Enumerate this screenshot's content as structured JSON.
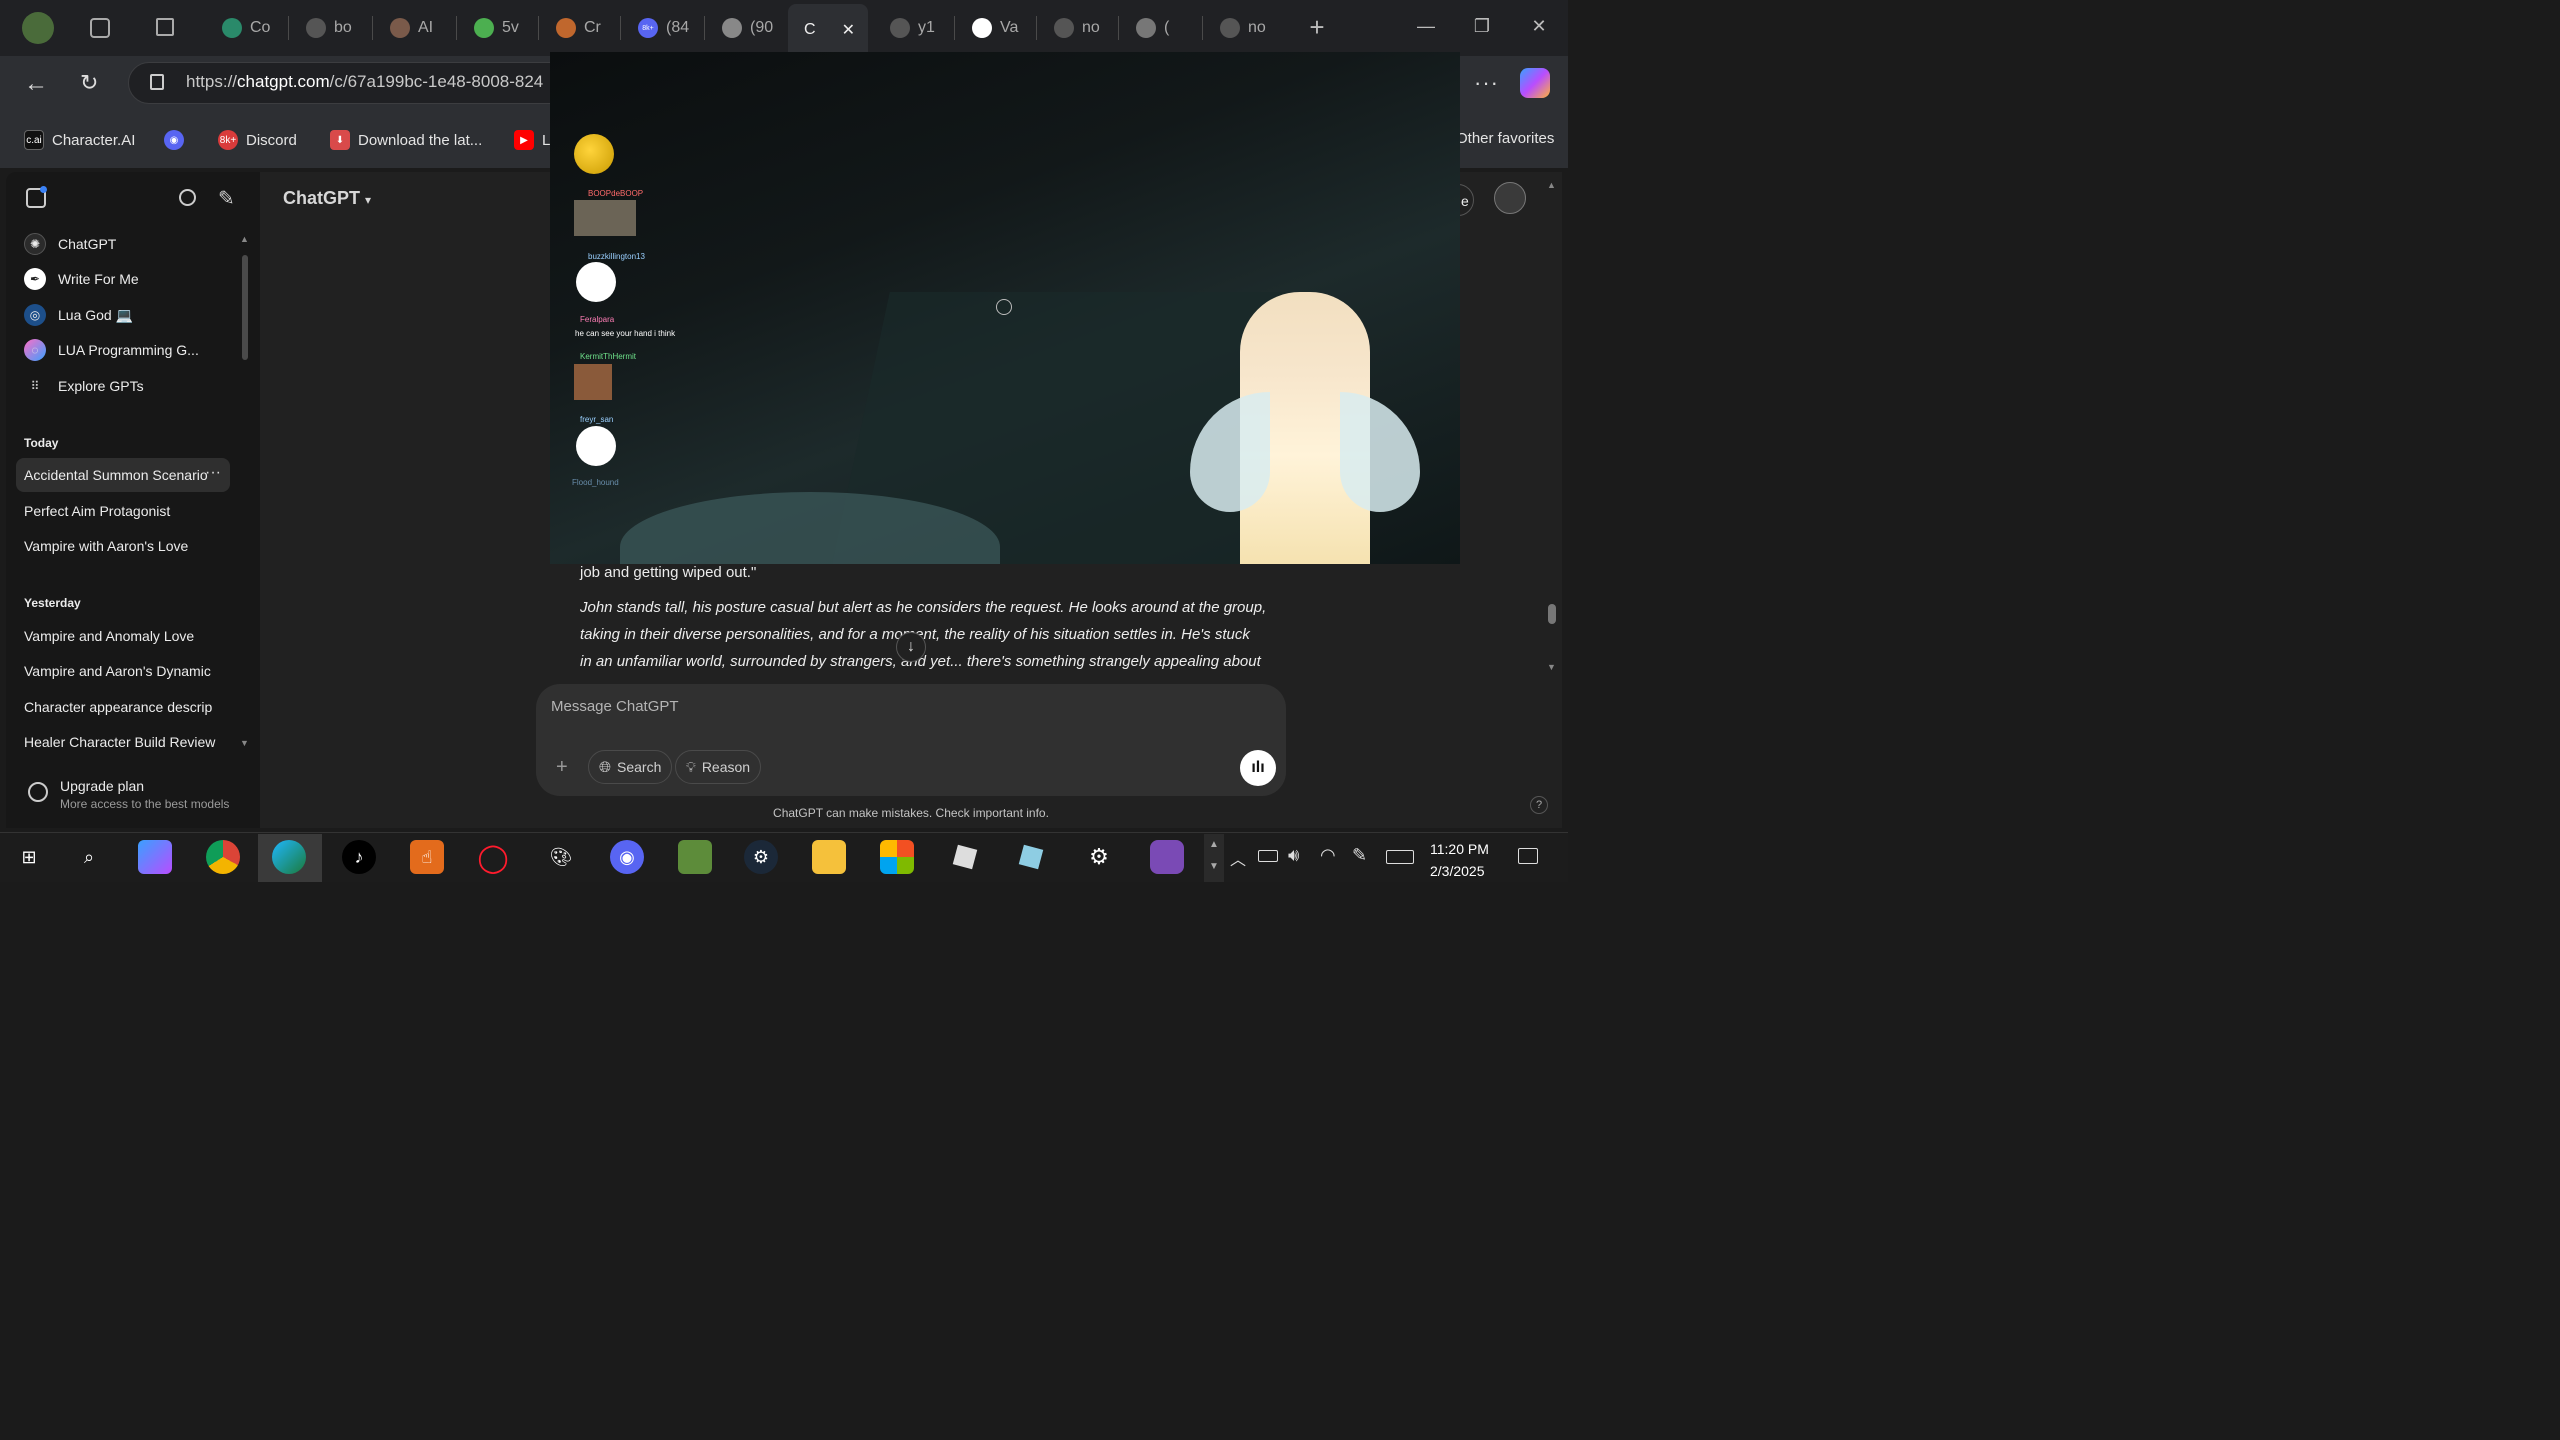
{
  "tabs": [
    {
      "label": "Co",
      "icon": "edge-copilot-icon",
      "color": "#2a8a6a"
    },
    {
      "label": "bo",
      "icon": "page-icon",
      "color": "#555"
    },
    {
      "label": "AI",
      "icon": "avatar-icon",
      "color": "#7a5a4a"
    },
    {
      "label": "5v",
      "icon": "pinwheel-icon",
      "color": "#4caf50"
    },
    {
      "label": "Cr",
      "icon": "pencil-icon",
      "color": "#c0672d"
    },
    {
      "label": "(84",
      "icon": "discord-icon",
      "color": "#5865f2",
      "badge": "8k+"
    },
    {
      "label": "(90",
      "icon": "pip-icon",
      "color": "#888"
    },
    {
      "label": "C",
      "icon": "close-icon",
      "active": true
    },
    {
      "label": "y1",
      "icon": "page-icon",
      "color": "#555"
    },
    {
      "label": "Va",
      "icon": "openai-icon",
      "color": "#fff"
    },
    {
      "label": "no",
      "icon": "page-icon",
      "color": "#555"
    },
    {
      "label": "(",
      "icon": "roblox-icon",
      "color": "#777"
    },
    {
      "label": "no",
      "icon": "page-icon",
      "color": "#555"
    }
  ],
  "address": {
    "scheme": "https://",
    "host": "chatgpt.com",
    "path": "/c/67a199bc-1e48-8008-824"
  },
  "bookmarks": [
    {
      "label": "Character.AI",
      "icon": "c-ai-icon",
      "text": "c.ai"
    },
    {
      "label": "",
      "icon": "discord-icon"
    },
    {
      "label": "Discord",
      "icon": "discord-badge-icon",
      "badge": "8k+"
    },
    {
      "label": "Download the lat...",
      "icon": "download-icon"
    },
    {
      "label": "L",
      "icon": "youtube-icon"
    },
    {
      "label": "Other favorites",
      "icon": "folder-icon"
    }
  ],
  "sidebar": {
    "gpts": [
      {
        "label": "ChatGPT",
        "icon": "openai-icon"
      },
      {
        "label": "Write For Me",
        "icon": "pen-icon"
      },
      {
        "label": "Lua God 💻",
        "icon": "lua-god-icon"
      },
      {
        "label": "LUA Programming G...",
        "icon": "lua-programming-icon"
      },
      {
        "label": "Explore GPTs",
        "icon": "grid-icon"
      }
    ],
    "today_label": "Today",
    "today": [
      "Accidental Summon Scenario",
      "Perfect Aim Protagonist",
      "Vampire with Aaron's Love"
    ],
    "yesterday_label": "Yesterday",
    "yesterday": [
      "Vampire and Anomaly Love",
      "Vampire and Aaron's Dynamic",
      "Character appearance descrip",
      "Healer Character Build Review"
    ],
    "upgrade_title": "Upgrade plan",
    "upgrade_sub": "More access to the best models"
  },
  "header": {
    "model": "ChatGPT",
    "share_text": "e"
  },
  "conversation": {
    "line0": "job and getting wiped out.\"",
    "para1_line1": "John stands tall, his posture casual but alert as he considers the request. He looks around at the group,",
    "para1_line2": "taking in their diverse personalities, and for a moment, the reality of his situation settles in. He's stuck",
    "para1_line3": "in an unfamiliar world, surrounded by strangers, and yet... there's something strangely appealing about"
  },
  "composer": {
    "placeholder": "Message ChatGPT",
    "search_label": "Search",
    "reason_label": "Reason"
  },
  "disclaimer": "ChatGPT can make mistakes. Check important info.",
  "overlay_chat": [
    {
      "user": "BOOPdeBOOP",
      "color": "#ff6b6b"
    },
    {
      "user": "buzzkillington13",
      "color": "#9ad0ff"
    },
    {
      "user": "Feralpara",
      "color": "#ff7eb6",
      "text": "he can see your hand i think"
    },
    {
      "user": "KermitThHermit",
      "color": "#6ee08a"
    },
    {
      "user": "freyr_san",
      "color": "#9ad0ff"
    },
    {
      "user": "Flood_hound",
      "color": "#9ad0ff"
    }
  ],
  "taskbar": [
    "windows-icon",
    "search-icon",
    "copilot-icon",
    "chrome-icon",
    "edge-icon",
    "tiktok-icon",
    "hand-app-icon",
    "opera-icon",
    "paint-icon",
    "discord-icon",
    "minecraft-icon",
    "steam-icon",
    "file-explorer-icon",
    "store-icon",
    "roblox-icon",
    "roblox-studio-icon",
    "settings-icon",
    "avatar-app-icon"
  ],
  "clock": {
    "time": "11:20 PM",
    "date": "2/3/2025"
  }
}
